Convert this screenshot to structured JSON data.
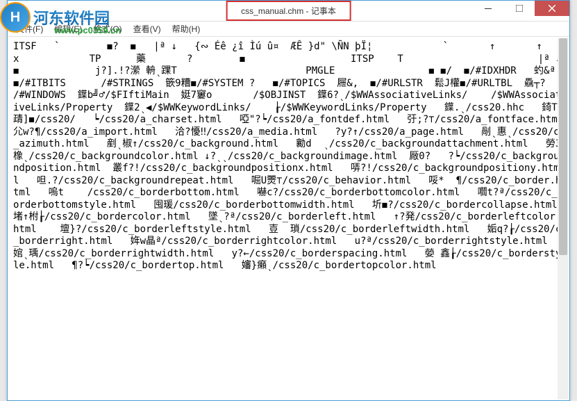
{
  "window": {
    "title": "css_manual.chm - 记事本"
  },
  "menu": {
    "file": "文件(F)",
    "edit": "编辑(E)",
    "format": "格式(O)",
    "view": "查看(V)",
    "help": "帮助(H)"
  },
  "logo": {
    "text": "河东软件园",
    "url": "www.pc0359.cn"
  },
  "content": "ITSF   `        ◼?  ◼   |ª ↓   {∾ Éê ¿î Ìú û¤  ÆÊ }d\" \\ÑN þÏ¦            `       ↑       ↑              x            TP      藥       ?        ◼                  ITSP    T                       |ª ↓           ◼             j?].!?瀠 輈ˎ踝T                      PMGLE                ◼ ◼/  ◼/#IDXHDR   虳&ª  ◼/#ITBITS      /#STRINGS  篏9糟◼/#SYSTEM ?   ◼/#TOPICS  屜&,  ◼/#URLSTR  鬆J權◼/#URLTBL  驫┬?          /#WINDOWS  鐷b╝♂/$FIftiMain  娗7窶o       /$OBJINST  鐷6?ˎ/$WWAssociativeLinks/    /$WWAssociativeLinks/Property  鐷2ˎ◀/$WWKeywordLinks/    ┟/$WWKeywordLinks/Property   鐷.ˎ/css20.hhc   錡T靕]◼/css20/   ┕/css20/a_charset.html   啞\"?┕/css20/a_fontdef.html   弙;?⊤/css20/a_fontface.html   尣w?¶/css20/a_import.html   洽?懮‼/css20/a_media.html   ?y?↑/css20/a_page.html   剮ˎ惠ˎ/css20/c_azimuth.html   剷ˎ椒↑/css20/c_background.html   勷d  ˎ/css20/c_backgroundattachment.html   勞3橡ˎ/css20/c_backgroundcolor.html ↓?ˎˎ/css20/c_backgroundimage.html  厰0?   ?┕/css20/c_backgroundposition.html  叢f?!/css20/c_backgroundpositionx.html   哢?!/css20/c_backgroundpositiony.html   呾.?/css20/c_backgroundrepeat.html   啒U燛⊤/css20/c_behavior.html   哸*  ¶/css20/c_border.html   嗚t    /css20/c_borderbottom.html   嚇c?/css20/c_borderbottomcolor.html   嚪t?ª/css20/c_borderbottomstyle.html   囤瑗/css20/c_borderbottomwidth.html   圻◼?/css20/c_bordercollapse.html   堵↑柎┟/css20/c_bordercolor.html   墜ˎ?ª/css20/c_borderleft.html   ↑?発/css20/c_borderleftcolor.html    壇}?/css20/c_borderleftstyle.html   壴  瑣/css20/c_borderleftwidth.html   姤q?┟/css20/c_borderright.html   姩w晶ª/css20/c_borderrightcolor.html   u?ª/css20/c_borderrightstyle.html   婠ˎ瑀/css20/c_borderrightwidth.html   y?←/css20/c_borderspacing.html   嫈 鑫┟/css20/c_borderstyle.html   ¶?┕/css20/c_bordertop.html   嬸}癩ˎ/css20/c_bordertopcolor.html"
}
